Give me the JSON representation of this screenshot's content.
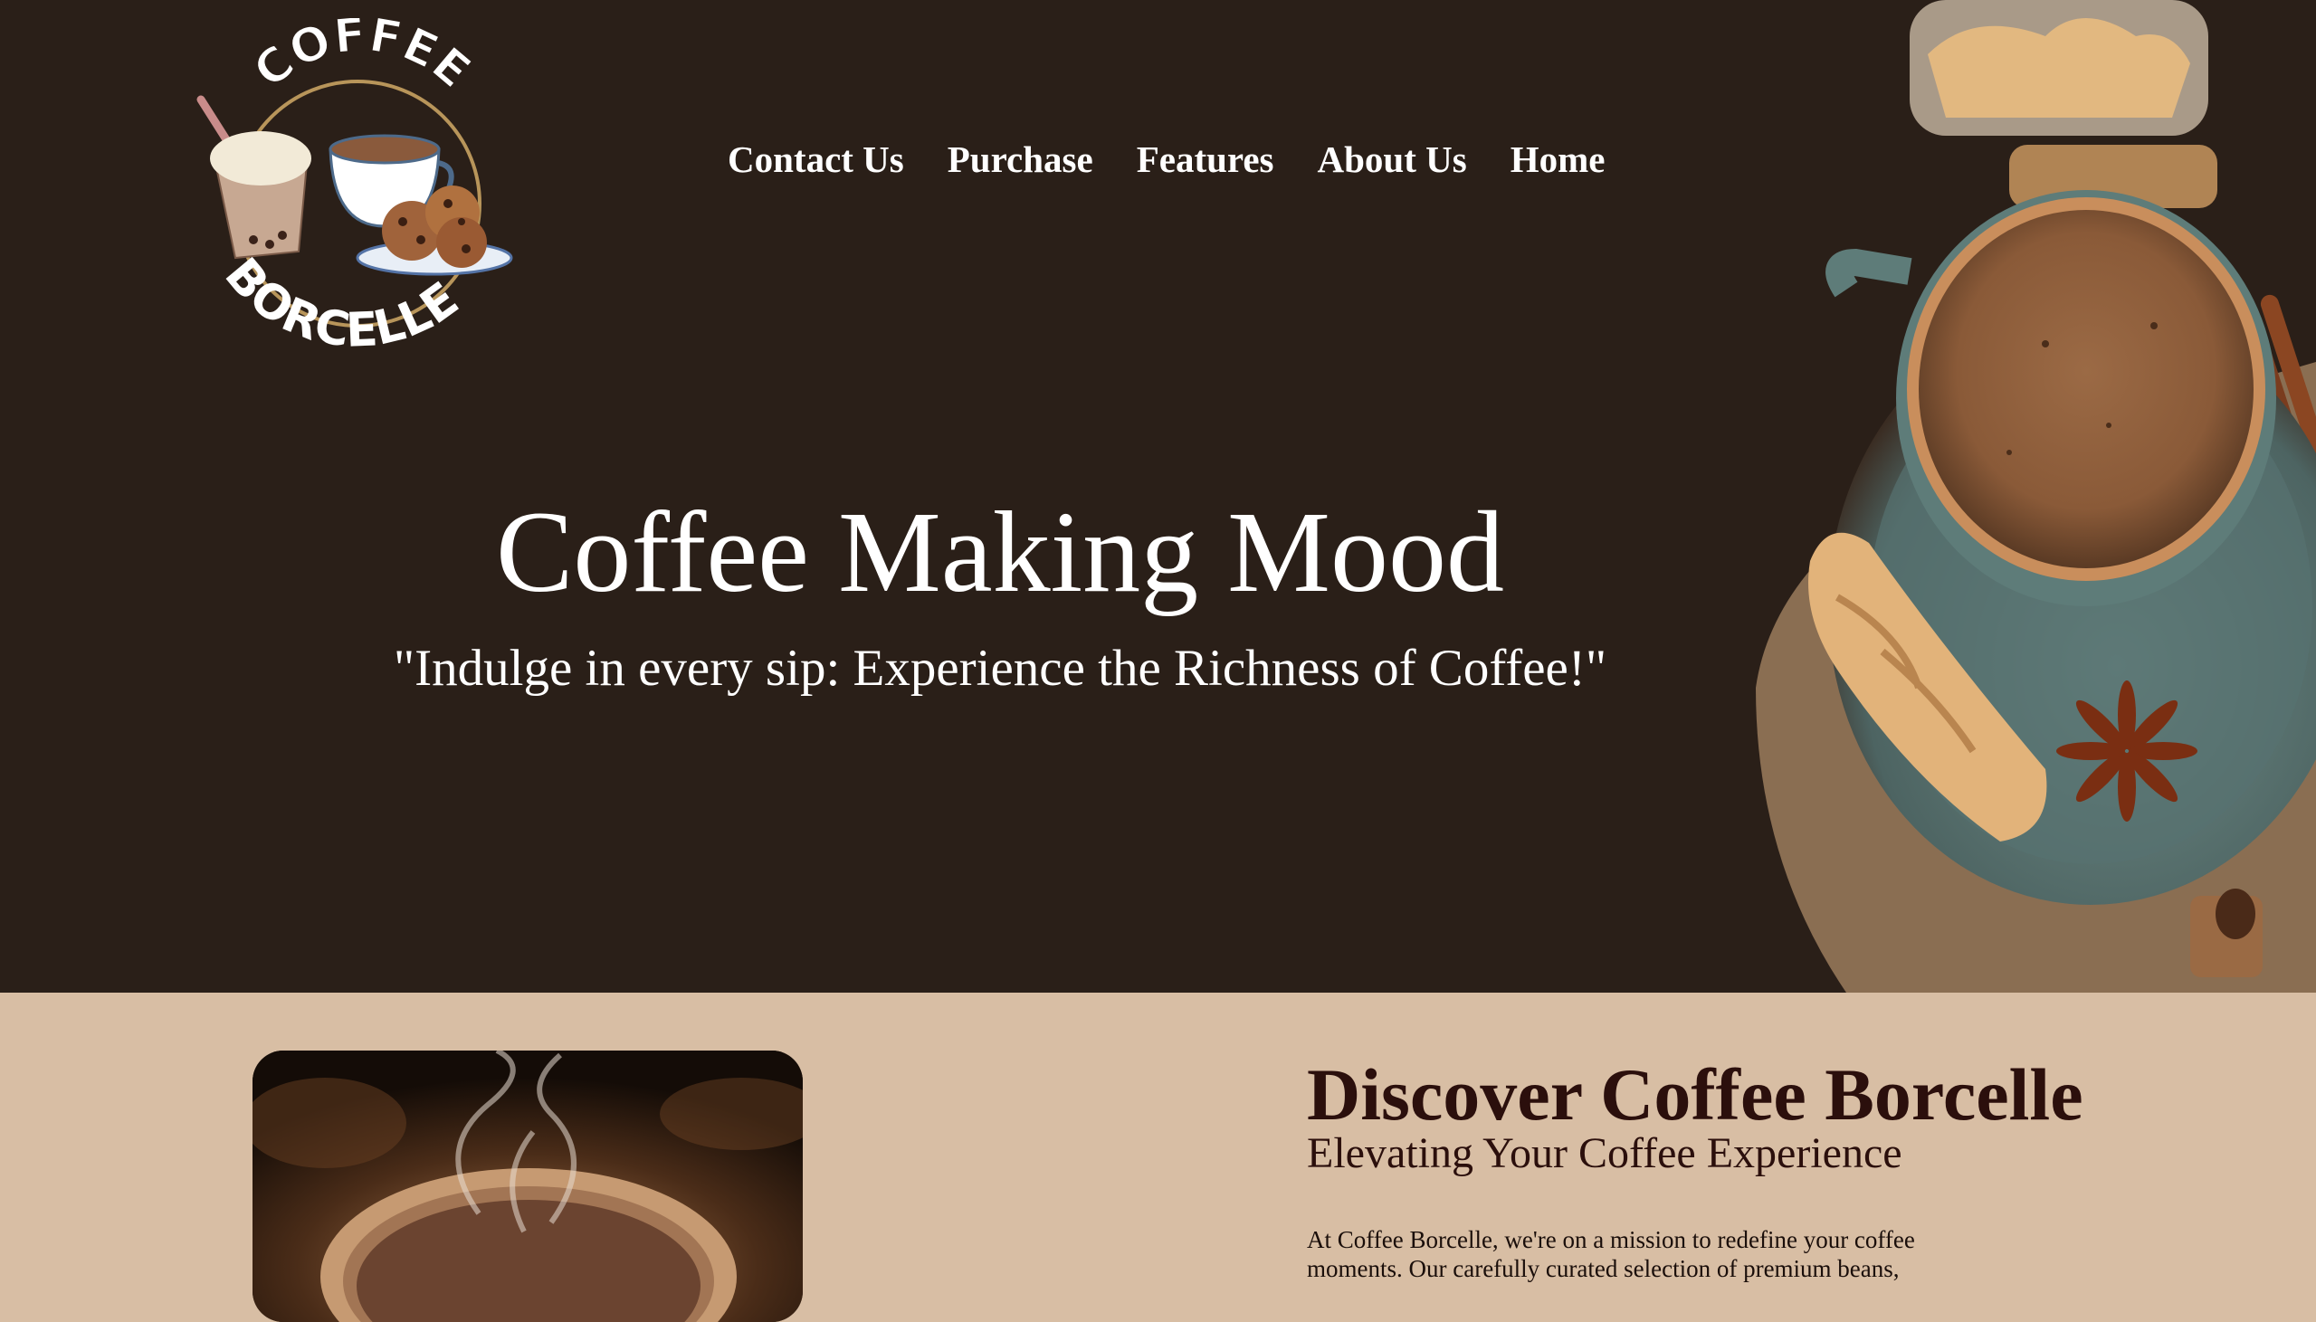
{
  "logo": {
    "top_text": "COFFEE",
    "bottom_text": "BORCELLE"
  },
  "nav": {
    "items": [
      {
        "label": "Contact Us"
      },
      {
        "label": "Purchase"
      },
      {
        "label": "Features"
      },
      {
        "label": "About Us"
      },
      {
        "label": "Home"
      }
    ]
  },
  "hero": {
    "title": "Coffee Making Mood",
    "subtitle": "\"Indulge in every sip: Experience the Richness of Coffee!\""
  },
  "about": {
    "title": "Discover Coffee Borcelle",
    "subtitle": "Elevating Your Coffee Experience",
    "text": "At Coffee Borcelle, we're on a mission to redefine your coffee moments. Our carefully curated selection of premium beans,"
  },
  "colors": {
    "hero_background": "#2a1f18",
    "about_background": "#d8bea4",
    "heading_color": "#2b0f0c",
    "nav_text": "#ffffff"
  }
}
